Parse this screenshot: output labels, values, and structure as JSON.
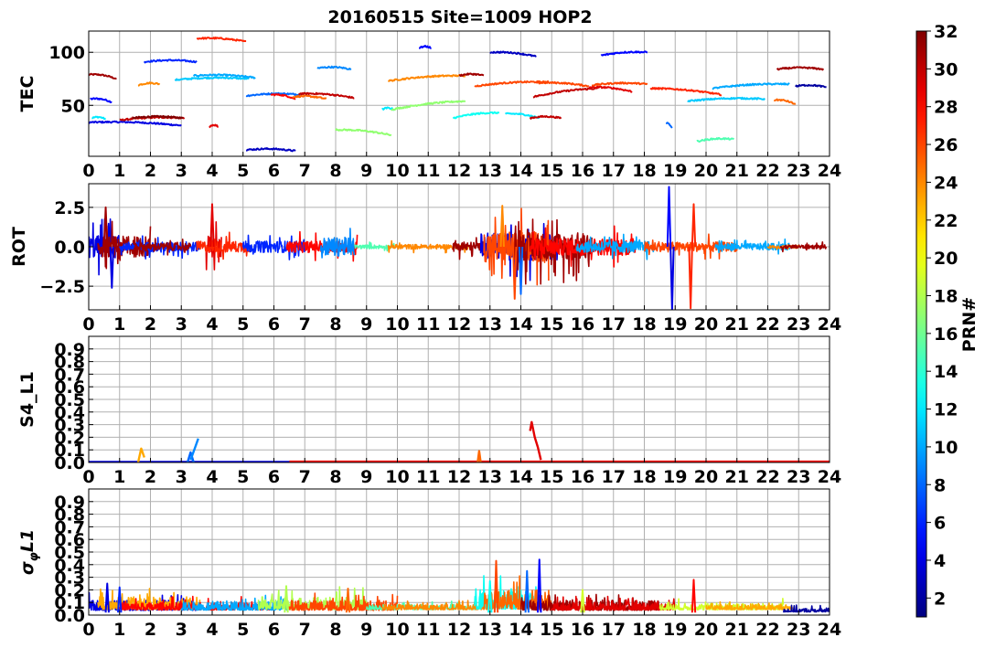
{
  "title": "20160515 Site=1009 HOP2",
  "colorbar": {
    "label": "PRN#",
    "ticks": [
      "2",
      "4",
      "6",
      "8",
      "10",
      "12",
      "14",
      "16",
      "18",
      "20",
      "22",
      "24",
      "26",
      "28",
      "30",
      "32"
    ],
    "range": [
      1,
      32
    ],
    "colormap": "jet"
  },
  "chart_data": [
    {
      "type": "line",
      "ylabel": "TEC",
      "xlim": [
        0,
        24
      ],
      "ylim": [
        2,
        120
      ],
      "xticks": [
        "0",
        "1",
        "2",
        "3",
        "4",
        "5",
        "6",
        "7",
        "8",
        "9",
        "10",
        "11",
        "12",
        "13",
        "14",
        "15",
        "16",
        "17",
        "18",
        "19",
        "20",
        "21",
        "22",
        "23",
        "24"
      ],
      "yticks": [
        {
          "v": 50,
          "t": "50"
        },
        {
          "v": 100,
          "t": "100"
        }
      ],
      "grid": true,
      "segments": [
        {
          "prn": 31,
          "x": [
            0.0,
            0.9
          ],
          "y": [
            79,
            75
          ]
        },
        {
          "prn": 5,
          "x": [
            0.05,
            0.75
          ],
          "y": [
            56,
            53
          ]
        },
        {
          "prn": 12,
          "x": [
            0.1,
            0.55
          ],
          "y": [
            38,
            37
          ]
        },
        {
          "prn": 4,
          "x": [
            0.0,
            3.0
          ],
          "y": [
            34,
            31
          ]
        },
        {
          "prn": 30,
          "x": [
            1.0,
            3.1
          ],
          "y": [
            36,
            38
          ]
        },
        {
          "prn": 32,
          "x": [
            1.4,
            3.05
          ],
          "y": [
            38,
            38
          ]
        },
        {
          "prn": 24,
          "x": [
            1.6,
            2.3
          ],
          "y": [
            69,
            70
          ]
        },
        {
          "prn": 6,
          "x": [
            1.8,
            3.5
          ],
          "y": [
            91,
            91
          ]
        },
        {
          "prn": 11,
          "x": [
            2.8,
            5.2
          ],
          "y": [
            74,
            75
          ]
        },
        {
          "prn": 10,
          "x": [
            3.4,
            5.4
          ],
          "y": [
            78,
            76
          ]
        },
        {
          "prn": 27,
          "x": [
            3.5,
            5.1
          ],
          "y": [
            113,
            110
          ]
        },
        {
          "prn": 29,
          "x": [
            3.9,
            4.2
          ],
          "y": [
            30,
            30
          ]
        },
        {
          "prn": 8,
          "x": [
            5.1,
            6.9
          ],
          "y": [
            59,
            60
          ]
        },
        {
          "prn": 3,
          "x": [
            5.1,
            6.7
          ],
          "y": [
            8,
            7
          ]
        },
        {
          "prn": 28,
          "x": [
            5.9,
            6.7
          ],
          "y": [
            60,
            56
          ]
        },
        {
          "prn": 25,
          "x": [
            6.6,
            7.7
          ],
          "y": [
            58,
            56
          ]
        },
        {
          "prn": 30,
          "x": [
            6.8,
            8.6
          ],
          "y": [
            61,
            57
          ]
        },
        {
          "prn": 9,
          "x": [
            7.4,
            8.5
          ],
          "y": [
            85,
            84
          ]
        },
        {
          "prn": 17,
          "x": [
            8.0,
            9.8
          ],
          "y": [
            27,
            22
          ]
        },
        {
          "prn": 12,
          "x": [
            9.5,
            9.9
          ],
          "y": [
            46,
            46
          ]
        },
        {
          "prn": 24,
          "x": [
            9.7,
            12.2
          ],
          "y": [
            73,
            78
          ]
        },
        {
          "prn": 17,
          "x": [
            9.8,
            12.2
          ],
          "y": [
            46,
            54
          ]
        },
        {
          "prn": 5,
          "x": [
            10.7,
            11.1
          ],
          "y": [
            104,
            104
          ]
        },
        {
          "prn": 31,
          "x": [
            12.0,
            12.8
          ],
          "y": [
            78,
            78
          ]
        },
        {
          "prn": 13,
          "x": [
            11.8,
            13.3
          ],
          "y": [
            38,
            43
          ]
        },
        {
          "prn": 12,
          "x": [
            13.5,
            14.6
          ],
          "y": [
            42,
            38
          ]
        },
        {
          "prn": 30,
          "x": [
            14.3,
            15.3
          ],
          "y": [
            38,
            38
          ]
        },
        {
          "prn": 26,
          "x": [
            12.5,
            14.9
          ],
          "y": [
            68,
            72
          ]
        },
        {
          "prn": 3,
          "x": [
            13.0,
            14.5
          ],
          "y": [
            100,
            96
          ]
        },
        {
          "prn": 26,
          "x": [
            14.5,
            16.2
          ],
          "y": [
            71,
            68
          ]
        },
        {
          "prn": 30,
          "x": [
            14.4,
            16.5
          ],
          "y": [
            58,
            66
          ]
        },
        {
          "prn": 29,
          "x": [
            16.2,
            17.6
          ],
          "y": [
            67,
            63
          ]
        },
        {
          "prn": 26,
          "x": [
            16.3,
            18.1
          ],
          "y": [
            69,
            70
          ]
        },
        {
          "prn": 5,
          "x": [
            16.6,
            18.1
          ],
          "y": [
            97,
            100
          ]
        },
        {
          "prn": 27,
          "x": [
            18.2,
            20.5
          ],
          "y": [
            66,
            60
          ]
        },
        {
          "prn": 8,
          "x": [
            18.7,
            18.9
          ],
          "y": [
            33,
            29
          ]
        },
        {
          "prn": 15,
          "x": [
            19.7,
            20.9
          ],
          "y": [
            16,
            18
          ]
        },
        {
          "prn": 11,
          "x": [
            19.4,
            21.9
          ],
          "y": [
            54,
            56
          ]
        },
        {
          "prn": 10,
          "x": [
            20.2,
            22.7
          ],
          "y": [
            66,
            70
          ]
        },
        {
          "prn": 25,
          "x": [
            22.2,
            22.9
          ],
          "y": [
            55,
            51
          ]
        },
        {
          "prn": 31,
          "x": [
            22.3,
            23.8
          ],
          "y": [
            84,
            84
          ]
        },
        {
          "prn": 2,
          "x": [
            22.9,
            23.9
          ],
          "y": [
            68,
            67
          ]
        }
      ]
    },
    {
      "type": "line",
      "ylabel": "ROT",
      "xlim": [
        0,
        24
      ],
      "ylim": [
        -4,
        4
      ],
      "xticks": [
        "0",
        "1",
        "2",
        "3",
        "4",
        "5",
        "6",
        "7",
        "8",
        "9",
        "10",
        "11",
        "12",
        "13",
        "14",
        "15",
        "16",
        "17",
        "18",
        "19",
        "20",
        "21",
        "22",
        "23",
        "24"
      ],
      "yticks": [
        {
          "v": 2.5,
          "t": "2.5"
        },
        {
          "v": 0,
          "t": "0.0"
        },
        {
          "v": -2.5,
          "t": "−2.5"
        }
      ],
      "grid": true,
      "noise": [
        {
          "prn": 4,
          "x0": 0.0,
          "x1": 1.0,
          "amp": 1.2
        },
        {
          "prn": 31,
          "x0": 0.3,
          "x1": 2.0,
          "amp": 1.1
        },
        {
          "prn": 6,
          "x0": 1.0,
          "x1": 3.6,
          "amp": 0.5
        },
        {
          "prn": 31,
          "x0": 1.5,
          "x1": 3.3,
          "amp": 0.4
        },
        {
          "prn": 29,
          "x0": 3.8,
          "x1": 4.3,
          "amp": 1.2
        },
        {
          "prn": 27,
          "x0": 3.5,
          "x1": 5.2,
          "amp": 0.6
        },
        {
          "prn": 6,
          "x0": 5.0,
          "x1": 7.0,
          "amp": 0.6
        },
        {
          "prn": 28,
          "x0": 6.4,
          "x1": 8.7,
          "amp": 0.6
        },
        {
          "prn": 9,
          "x0": 7.5,
          "x1": 8.6,
          "amp": 1.0
        },
        {
          "prn": 15,
          "x0": 8.6,
          "x1": 9.9,
          "amp": 0.2
        },
        {
          "prn": 24,
          "x0": 9.7,
          "x1": 12.3,
          "amp": 0.25
        },
        {
          "prn": 31,
          "x0": 11.8,
          "x1": 13.0,
          "amp": 0.5
        },
        {
          "prn": 4,
          "x0": 12.7,
          "x1": 15.2,
          "amp": 1.4
        },
        {
          "prn": 26,
          "x0": 12.8,
          "x1": 14.9,
          "amp": 1.6
        },
        {
          "prn": 31,
          "x0": 13.8,
          "x1": 16.3,
          "amp": 1.5
        },
        {
          "prn": 28,
          "x0": 14.3,
          "x1": 17.7,
          "amp": 0.9
        },
        {
          "prn": 10,
          "x0": 15.8,
          "x1": 18.3,
          "amp": 0.6
        },
        {
          "prn": 26,
          "x0": 18.0,
          "x1": 21.0,
          "amp": 0.5
        },
        {
          "prn": 10,
          "x0": 20.3,
          "x1": 22.7,
          "amp": 0.35
        },
        {
          "prn": 24,
          "x0": 22.0,
          "x1": 23.0,
          "amp": 0.15
        },
        {
          "prn": 31,
          "x0": 22.4,
          "x1": 23.9,
          "amp": 0.2
        }
      ],
      "spikes": [
        {
          "prn": 31,
          "x": 0.55,
          "y": 2.5
        },
        {
          "prn": 4,
          "x": 0.75,
          "y": -2.6
        },
        {
          "prn": 29,
          "x": 4.0,
          "y": 2.7
        },
        {
          "prn": 8,
          "x": 14.0,
          "y": -3.0
        },
        {
          "prn": 24,
          "x": 13.4,
          "y": 2.6
        },
        {
          "prn": 26,
          "x": 13.8,
          "y": -3.3
        },
        {
          "prn": 5,
          "x": 18.8,
          "y": 3.8
        },
        {
          "prn": 4,
          "x": 18.9,
          "y": -4.0
        },
        {
          "prn": 27,
          "x": 19.5,
          "y": -3.9
        },
        {
          "prn": 27,
          "x": 19.6,
          "y": 2.7
        }
      ]
    },
    {
      "type": "line",
      "ylabel": "S4_L1",
      "xlim": [
        0,
        24
      ],
      "ylim": [
        0,
        1.0
      ],
      "xticks": [
        "0",
        "1",
        "2",
        "3",
        "4",
        "5",
        "6",
        "7",
        "8",
        "9",
        "10",
        "11",
        "12",
        "13",
        "14",
        "15",
        "16",
        "17",
        "18",
        "19",
        "20",
        "21",
        "22",
        "23",
        "24"
      ],
      "yticks": [
        {
          "v": 0.0,
          "t": "0.0"
        },
        {
          "v": 0.1,
          "t": "0.1"
        },
        {
          "v": 0.2,
          "t": "0.2"
        },
        {
          "v": 0.3,
          "t": "0.3"
        },
        {
          "v": 0.4,
          "t": "0.4"
        },
        {
          "v": 0.5,
          "t": "0.5"
        },
        {
          "v": 0.6,
          "t": "0.6"
        },
        {
          "v": 0.7,
          "t": "0.7"
        },
        {
          "v": 0.8,
          "t": "0.8"
        },
        {
          "v": 0.9,
          "t": "0.9"
        }
      ],
      "grid": true,
      "baseline": [
        {
          "prn": 4,
          "x0": 0.0,
          "x1": 24.0,
          "y": 0.005
        },
        {
          "prn": 28,
          "x0": 6.5,
          "x1": 24.0,
          "y": 0.008
        }
      ],
      "peaks": [
        {
          "prn": 23,
          "x": [
            1.6,
            1.7,
            1.8
          ],
          "y": [
            0.0,
            0.11,
            0.04
          ]
        },
        {
          "prn": 8,
          "x": [
            3.2,
            3.3,
            3.4
          ],
          "y": [
            0.0,
            0.08,
            0.0
          ]
        },
        {
          "prn": 9,
          "x": [
            3.3,
            3.45,
            3.55
          ],
          "y": [
            0.02,
            0.12,
            0.19
          ]
        },
        {
          "prn": 25,
          "x": [
            12.6,
            12.65,
            12.7
          ],
          "y": [
            0.0,
            0.09,
            0.0
          ]
        },
        {
          "prn": 29,
          "x": [
            14.3,
            14.35,
            14.45,
            14.55,
            14.65
          ],
          "y": [
            0.25,
            0.32,
            0.2,
            0.12,
            0.02
          ]
        }
      ]
    },
    {
      "type": "line",
      "ylabel": "σφL1",
      "xlim": [
        0,
        24
      ],
      "ylim": [
        0,
        1.0
      ],
      "xticks": [
        "0",
        "1",
        "2",
        "3",
        "4",
        "5",
        "6",
        "7",
        "8",
        "9",
        "10",
        "11",
        "12",
        "13",
        "14",
        "15",
        "16",
        "17",
        "18",
        "19",
        "20",
        "21",
        "22",
        "23",
        "24"
      ],
      "yticks": [
        {
          "v": 0.0,
          "t": "0.0"
        },
        {
          "v": 0.1,
          "t": "0.1"
        },
        {
          "v": 0.2,
          "t": "0.2"
        },
        {
          "v": 0.3,
          "t": "0.3"
        },
        {
          "v": 0.4,
          "t": "0.4"
        },
        {
          "v": 0.5,
          "t": "0.5"
        },
        {
          "v": 0.6,
          "t": "0.6"
        },
        {
          "v": 0.7,
          "t": "0.7"
        },
        {
          "v": 0.8,
          "t": "0.8"
        },
        {
          "v": 0.9,
          "t": "0.9"
        }
      ],
      "grid": true,
      "noise": [
        {
          "prn": 4,
          "x0": 0.0,
          "x1": 3.5,
          "base": 0.05,
          "amp": 0.08
        },
        {
          "prn": 23,
          "x0": 0.3,
          "x1": 3.6,
          "base": 0.06,
          "amp": 0.1
        },
        {
          "prn": 28,
          "x0": 1.0,
          "x1": 6.0,
          "base": 0.05,
          "amp": 0.06
        },
        {
          "prn": 10,
          "x0": 3.0,
          "x1": 6.5,
          "base": 0.05,
          "amp": 0.07
        },
        {
          "prn": 18,
          "x0": 5.5,
          "x1": 9.0,
          "base": 0.06,
          "amp": 0.1
        },
        {
          "prn": 26,
          "x0": 6.5,
          "x1": 10.0,
          "base": 0.05,
          "amp": 0.08
        },
        {
          "prn": 15,
          "x0": 9.0,
          "x1": 12.5,
          "base": 0.05,
          "amp": 0.04
        },
        {
          "prn": 24,
          "x0": 9.5,
          "x1": 13.0,
          "base": 0.05,
          "amp": 0.04
        },
        {
          "prn": 13,
          "x0": 12.5,
          "x1": 14.5,
          "base": 0.07,
          "amp": 0.15
        },
        {
          "prn": 25,
          "x0": 12.8,
          "x1": 15.0,
          "base": 0.07,
          "amp": 0.15
        },
        {
          "prn": 31,
          "x0": 14.0,
          "x1": 18.5,
          "base": 0.05,
          "amp": 0.08
        },
        {
          "prn": 29,
          "x0": 15.0,
          "x1": 19.0,
          "base": 0.05,
          "amp": 0.06
        },
        {
          "prn": 19,
          "x0": 18.5,
          "x1": 22.5,
          "base": 0.05,
          "amp": 0.05
        },
        {
          "prn": 23,
          "x0": 20.0,
          "x1": 22.8,
          "base": 0.05,
          "amp": 0.04
        },
        {
          "prn": 2,
          "x0": 22.5,
          "x1": 24.0,
          "base": 0.03,
          "amp": 0.03
        }
      ],
      "spikes": [
        {
          "prn": 4,
          "x": 0.6,
          "y": 0.25
        },
        {
          "prn": 6,
          "x": 1.0,
          "y": 0.22
        },
        {
          "prn": 26,
          "x": 13.2,
          "y": 0.43
        },
        {
          "prn": 13,
          "x": 13.0,
          "y": 0.27
        },
        {
          "prn": 5,
          "x": 14.6,
          "y": 0.44
        },
        {
          "prn": 8,
          "x": 14.2,
          "y": 0.35
        },
        {
          "prn": 19,
          "x": 16.0,
          "y": 0.2
        },
        {
          "prn": 28,
          "x": 19.6,
          "y": 0.28
        },
        {
          "prn": 18,
          "x": 6.4,
          "y": 0.23
        },
        {
          "prn": 25,
          "x": 8.4,
          "y": 0.21
        }
      ]
    }
  ]
}
